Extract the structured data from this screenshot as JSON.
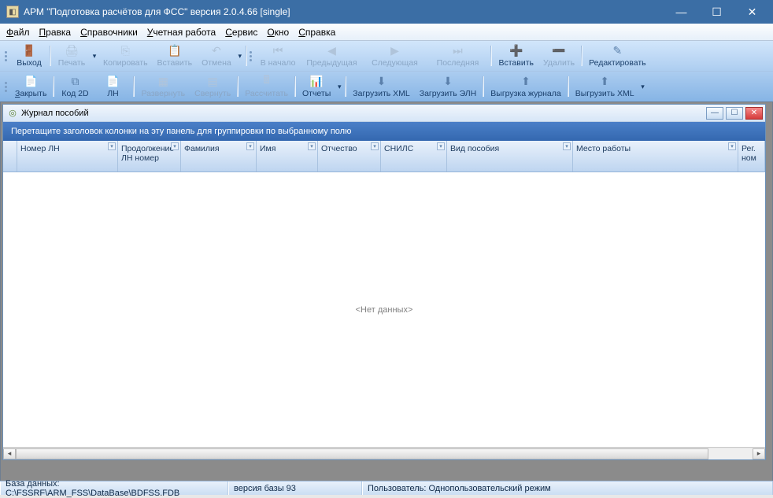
{
  "titlebar": {
    "text": "АРМ \"Подготовка расчётов для ФСС\"   версия 2.0.4.66 [single]"
  },
  "menu": {
    "file": "айл",
    "file_u": "Ф",
    "edit": "равка",
    "edit_u": "П",
    "ref": "правочники",
    "ref_u": "С",
    "acc": "четная работа",
    "acc_u": "У",
    "svc": "ервис",
    "svc_u": "С",
    "win": "кно",
    "win_u": "О",
    "help": "правка",
    "help_u": "С"
  },
  "tb1": {
    "exit": "Выход",
    "print": "Печать",
    "copy": "Копировать",
    "paste": "Вставить",
    "undo": "Отмена",
    "first": "В начало",
    "prev": "Предыдущая",
    "next": "Следующая",
    "last": "Последняя",
    "insert": "Вставить",
    "delete": "Удалить",
    "edit": "Редактировать"
  },
  "tb2": {
    "close": "акрыть",
    "close_u": "З",
    "code2d": "Код 2D",
    "ln": "ЛН",
    "expand": "Развернуть",
    "collapse": "Свернуть",
    "calc": "Рассчитать",
    "reports": "Отчеты",
    "loadxml": "Загрузить XML",
    "loadeln": "Загрузить ЭЛН",
    "exportlog": "Выгрузка журнала",
    "exportxml": "Выгрузить XML"
  },
  "mdi": {
    "title": "Журнал пособий"
  },
  "group_hint": "Перетащите заголовок колонки на эту панель для группировки по выбранному полю",
  "columns": {
    "c1": "Номер ЛН",
    "c2": "Продолжение ЛН номер",
    "c3": "Фамилия",
    "c4": "Имя",
    "c5": "Отчество",
    "c6": "СНИЛС",
    "c7": "Вид пособия",
    "c8": "Место работы",
    "c9": "Рег. ном"
  },
  "no_data": "<Нет данных>",
  "status": {
    "db": "База данных: C:\\FSSRF\\ARM_FSS\\DataBase\\BDFSS.FDB",
    "ver": "версия базы 93",
    "user": "Пользователь: Однопользовательский режим"
  }
}
